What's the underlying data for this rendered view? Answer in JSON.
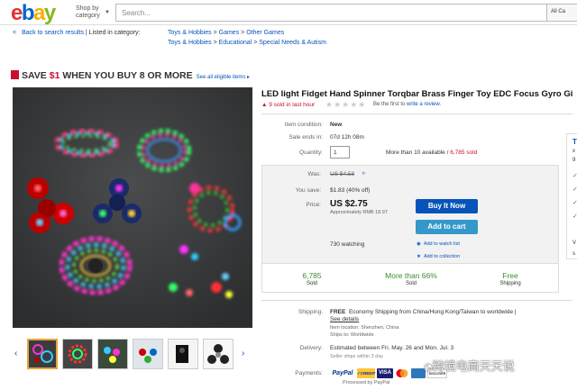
{
  "header": {
    "logo_letters": [
      "e",
      "b",
      "a",
      "y"
    ],
    "logo_colors": [
      "#e53238",
      "#0064d2",
      "#f5af02",
      "#86b817"
    ],
    "shop_by_category": "Shop by category",
    "search_placeholder": "Search...",
    "search_category": "All Ca"
  },
  "breadcrumb": {
    "back_link": "Back to search results",
    "separator": "| Listed in category:",
    "row1": [
      "Toys & Hobbies",
      ">",
      "Games",
      ">",
      "Other Games"
    ],
    "row2": [
      "Toys & Hobbies",
      ">",
      "Educational",
      ">",
      "Special Needs & Autism"
    ]
  },
  "promo": {
    "prefix": "SAVE ",
    "amount": "$1",
    "suffix": " WHEN YOU BUY 8 OR MORE",
    "see_all": "See all eligible items ▸"
  },
  "item": {
    "title": "LED light Fidget Hand Spinner Torqbar Brass Finger Toy EDC Focus Gyro Gi",
    "sold_last_hour": "9 sold in last hour",
    "first_review_prefix": "Be the first to ",
    "write_review": "write a review.",
    "condition_label": "Item condition:",
    "condition_value": "New",
    "ends_label": "Sale ends in:",
    "ends_value": "07d 12h 08m",
    "quantity_label": "Quantity:",
    "quantity_value": "1",
    "availability": "More than 10 available / ",
    "sold_count_link": "6,785 sold"
  },
  "pricing": {
    "was_label": "Was:",
    "was_value": "US $4.58",
    "save_label": "You save:",
    "save_value": "$1.83 (40% off)",
    "price_label": "Price:",
    "price_value": "US $2.75",
    "approx": "Approximately RMB 18.97",
    "buy_now": "Buy It Now",
    "add_to_cart": "Add to cart",
    "watching": "730 watching",
    "add_watch": "Add to watch list",
    "add_collection": "Add to collection"
  },
  "stats": [
    {
      "big": "6,785",
      "small": "Sold"
    },
    {
      "big": "More than 66%",
      "small": "Sold"
    },
    {
      "big": "Free",
      "small": "Shipping"
    }
  ],
  "right_card": {
    "letters": [
      "T",
      "x",
      "9"
    ],
    "checks": [
      "✓",
      "✓",
      "✓",
      "✓"
    ],
    "more_letter": "V",
    "bottom_letter": "s"
  },
  "shipping": {
    "label": "Shipping:",
    "free": "FREE",
    "method": "Economy Shipping from China/Hong Kong/Taiwan to worldwide |",
    "see_details": "See details",
    "location": "Item location:  Shenzhen, China",
    "ships_to": "Ships to:  Worldwide"
  },
  "delivery": {
    "label": "Delivery:",
    "estimate": "Estimated between Fri. May. 26 and Mon. Jul. 3",
    "seller_note": "Seller ships within 3 day"
  },
  "payments": {
    "label": "Payments:",
    "paypal": "PayPal",
    "credit": "✓CREDIT",
    "visa": "VISA",
    "discover": "DISCOVER",
    "processed_by": "Processed by PayPal"
  },
  "watermark": "跨境电商天天说"
}
